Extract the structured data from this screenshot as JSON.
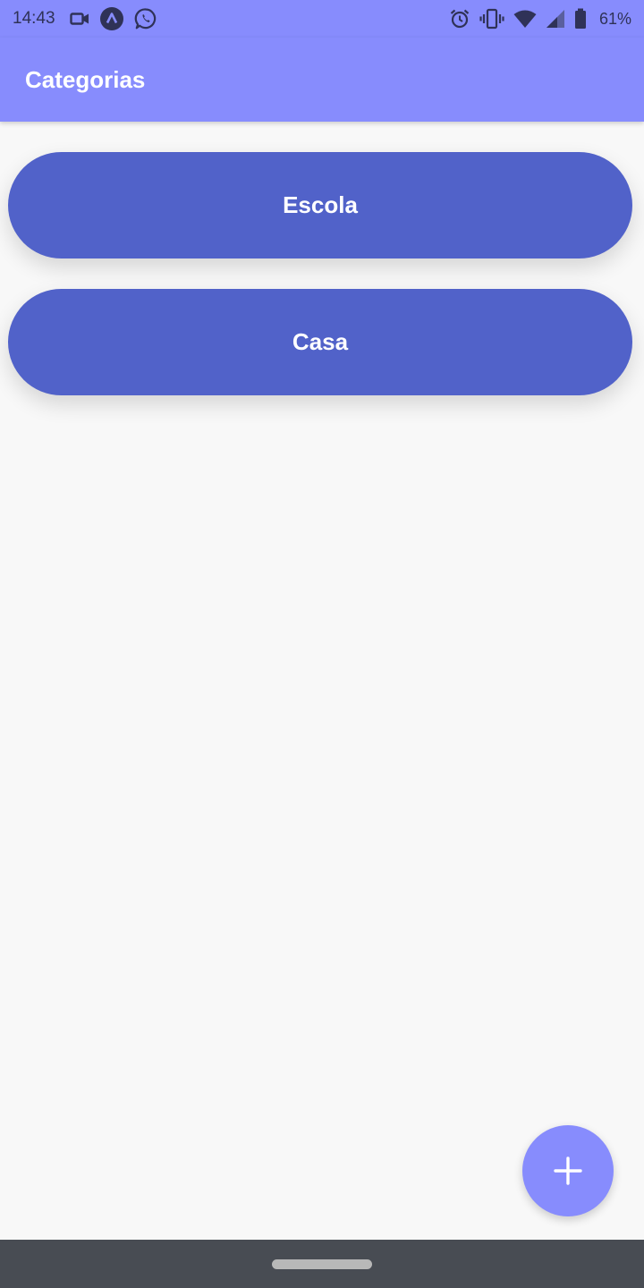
{
  "status_bar": {
    "time": "14:43",
    "battery_percent": "61%",
    "left_icons": [
      "video-camera-icon",
      "arch-app-icon",
      "whatsapp-icon"
    ],
    "right_icons": [
      "alarm-icon",
      "vibrate-icon",
      "wifi-icon",
      "cell-signal-icon",
      "battery-icon"
    ]
  },
  "app_bar": {
    "title": "Categorias"
  },
  "categories": [
    {
      "label": "Escola"
    },
    {
      "label": "Casa"
    }
  ],
  "fab": {
    "icon": "plus-icon"
  },
  "colors": {
    "primary": "#878cfd",
    "category_button": "#5162c9",
    "background": "#f8f8f8",
    "nav_bar": "#484c53",
    "status_icons": "#2f3257"
  }
}
